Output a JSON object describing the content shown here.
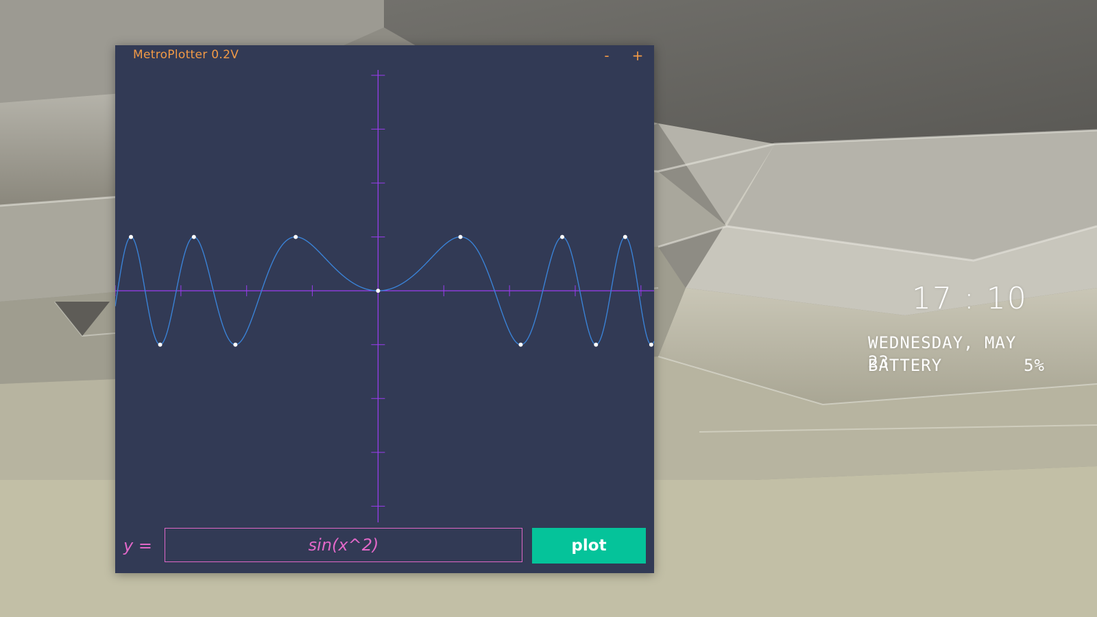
{
  "window": {
    "title": "MetroPlotter 0.2V",
    "minimize_label": "-",
    "maximize_label": "+",
    "colors": {
      "background": "#323a55",
      "title": "#f29a46",
      "axis": "#9b3cf0",
      "curve": "#3a82d6",
      "input": "#e168c8",
      "button": "#05c39a"
    }
  },
  "plot": {
    "function": "sin(x^2)",
    "x_range": [
      -4,
      4.2
    ],
    "y_range": [
      -4.3,
      4.1
    ],
    "tick_step": 1
  },
  "input": {
    "label": "y =",
    "value": "sin(x^2)"
  },
  "plot_button": {
    "label": "plot"
  },
  "desktop": {
    "time": "17 : 10",
    "date": "WEDNESDAY, MAY 23",
    "battery_label": "BATTERY",
    "battery_value": "5%"
  }
}
